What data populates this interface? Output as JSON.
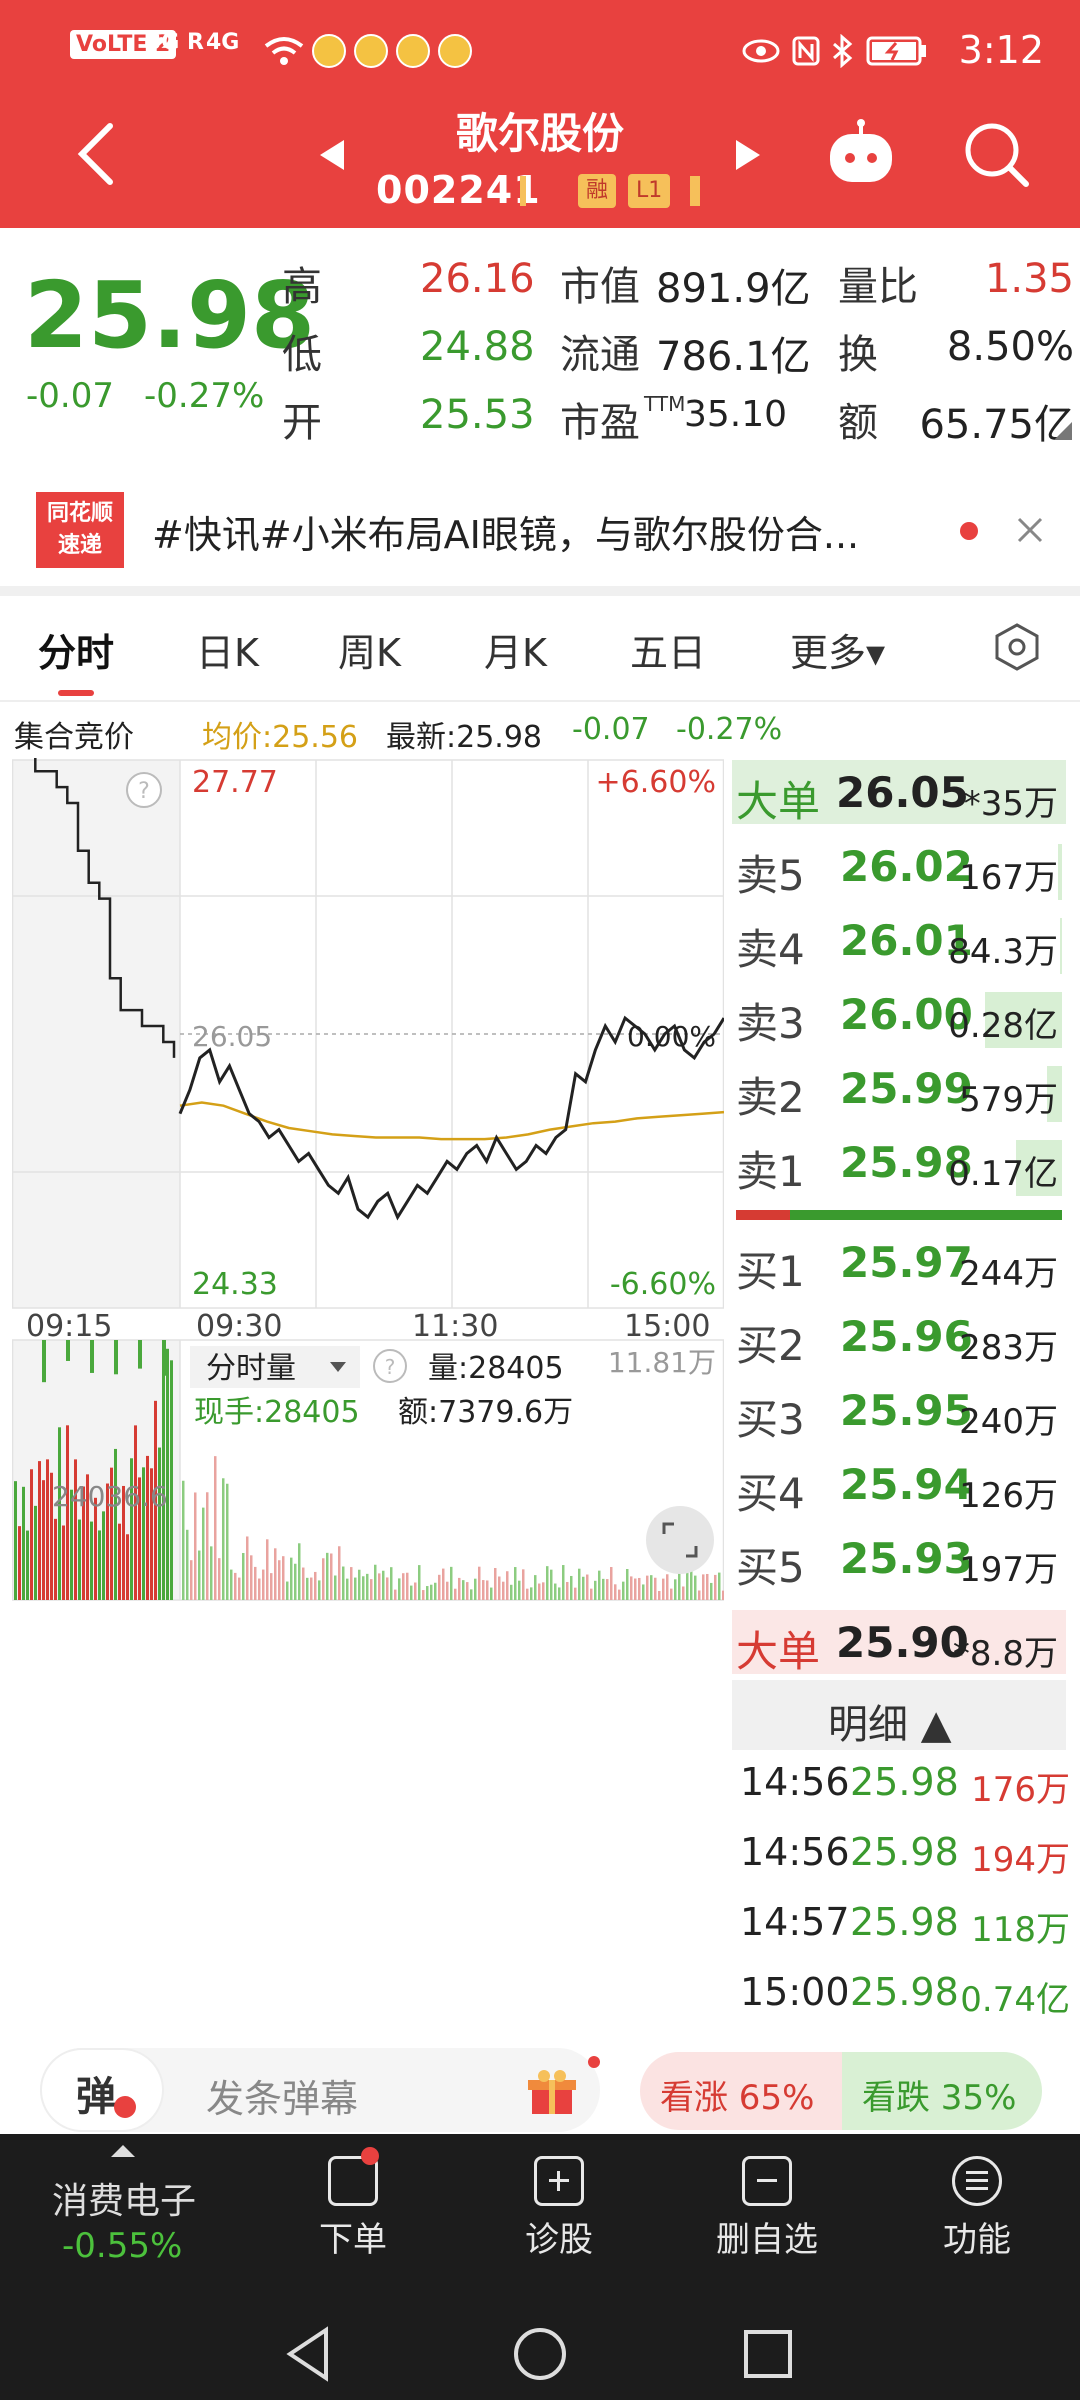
{
  "status_bar": {
    "time": "3:12",
    "signals": [
      "VoLTE 2",
      "3G R",
      "4G"
    ],
    "wifi_icon": "wifi-icon",
    "bluetooth_icon": "bluetooth-icon",
    "nfc_icon": "nfc-icon",
    "eye_icon": "eye-icon",
    "battery_icon": "battery-icon"
  },
  "header": {
    "stock_name": "歌尔股份",
    "stock_code": "002241",
    "tags": [
      "融",
      "L1"
    ],
    "brand_color": "#e8413f"
  },
  "quote": {
    "price": "25.98",
    "change": "-0.07",
    "change_pct": "-0.27%",
    "stats": {
      "high_label": "高",
      "high": "26.16",
      "low_label": "低",
      "low": "24.88",
      "open_label": "开",
      "open": "25.53",
      "mcap_label": "市值",
      "mcap": "891.9亿",
      "float_label": "流通",
      "float": "786.1亿",
      "pe_label": "市盈",
      "pe_suffix": "TTM",
      "pe": "35.10",
      "vr_label": "量比",
      "vr": "1.35",
      "turn_label": "换",
      "turn": "8.50%",
      "amt_label": "额",
      "amt": "65.75亿"
    }
  },
  "news": {
    "logo_top": "同花顺",
    "logo_bottom": "速递",
    "text": "#快讯#小米布局AI眼镜，与歌尔股份合..."
  },
  "tabs": [
    "分时",
    "日K",
    "周K",
    "月K",
    "五日",
    "更多▾"
  ],
  "chart_header": {
    "auction": "集合竞价",
    "avg": "均价:25.56",
    "latest": "最新:25.98",
    "chg": "-0.07",
    "chg_pct": "-0.27%"
  },
  "chart_data": {
    "type": "line",
    "price_axis": {
      "max": 27.77,
      "min": 24.33,
      "ref": 26.05,
      "max_pct": "+6.60%",
      "min_pct": "-6.60%",
      "ref_pct": "0.00%"
    },
    "y_labels": {
      "top": "27.77",
      "bottom": "24.33",
      "mid": "26.05",
      "top_pct": "+6.60%",
      "bottom_pct": "-6.60%",
      "mid_pct": "0.00%"
    },
    "x_labels": [
      "09:15",
      "09:30",
      "11:30",
      "15:00"
    ],
    "auction_series": [
      27.8,
      27.8,
      27.7,
      27.7,
      27.6,
      27.5,
      27.2,
      27.0,
      26.9,
      26.4,
      26.2,
      26.2,
      26.1,
      26.1,
      26.0,
      25.9
    ],
    "price_series": [
      25.55,
      25.7,
      25.9,
      25.95,
      25.75,
      25.85,
      25.7,
      25.55,
      25.5,
      25.4,
      25.45,
      25.35,
      25.25,
      25.3,
      25.2,
      25.1,
      25.05,
      25.15,
      24.95,
      24.9,
      25.0,
      25.05,
      24.9,
      25.0,
      25.1,
      25.05,
      25.15,
      25.25,
      25.2,
      25.3,
      25.35,
      25.25,
      25.4,
      25.3,
      25.2,
      25.25,
      25.35,
      25.3,
      25.4,
      25.45,
      25.8,
      25.75,
      25.95,
      26.1,
      26.0,
      26.15,
      26.1,
      26.05,
      25.95,
      26.05,
      26.1,
      25.95,
      25.9,
      26.0,
      26.05,
      26.15
    ],
    "avg_series": [
      25.6,
      25.62,
      25.6,
      25.55,
      25.5,
      25.46,
      25.44,
      25.42,
      25.41,
      25.4,
      25.4,
      25.4,
      25.39,
      25.39,
      25.39,
      25.4,
      25.42,
      25.45,
      25.47,
      25.49,
      25.5,
      25.52,
      25.53,
      25.54,
      25.55,
      25.56
    ],
    "volume": {
      "label": "分时量",
      "vol_label": "量:28405",
      "max_label": "11.81万",
      "hand_label": "现手:28405",
      "amount_label": "额:7379.6万",
      "auction_label": "24036.6"
    }
  },
  "order_book": {
    "big_sell": {
      "label": "大单",
      "price": "26.05",
      "vol": "*35万"
    },
    "sells": [
      {
        "label": "卖5",
        "price": "26.02",
        "vol": "167万",
        "share": 0.04
      },
      {
        "label": "卖4",
        "price": "26.01",
        "vol": "84.3万",
        "share": 0.02
      },
      {
        "label": "卖3",
        "price": "26.00",
        "vol": "0.28亿",
        "share": 0.7
      },
      {
        "label": "卖2",
        "price": "25.99",
        "vol": "579万",
        "share": 0.14
      },
      {
        "label": "卖1",
        "price": "25.98",
        "vol": "0.17亿",
        "share": 0.42
      }
    ],
    "buys": [
      {
        "label": "买1",
        "price": "25.97",
        "vol": "244万"
      },
      {
        "label": "买2",
        "price": "25.96",
        "vol": "283万"
      },
      {
        "label": "买3",
        "price": "25.95",
        "vol": "240万"
      },
      {
        "label": "买4",
        "price": "25.94",
        "vol": "126万"
      },
      {
        "label": "买5",
        "price": "25.93",
        "vol": "197万"
      }
    ],
    "big_buy": {
      "label": "大单",
      "price": "25.90",
      "vol": "*8.8万"
    }
  },
  "detail": {
    "title": "明细 ▲",
    "rows": [
      {
        "time": "14:56",
        "price": "25.98",
        "vol": "176万",
        "color": "red"
      },
      {
        "time": "14:56",
        "price": "25.98",
        "vol": "194万",
        "color": "red"
      },
      {
        "time": "14:57",
        "price": "25.98",
        "vol": "118万",
        "color": "green"
      },
      {
        "time": "15:00",
        "price": "25.98",
        "vol": "0.74亿",
        "color": "green"
      }
    ]
  },
  "danmu": {
    "icon_label": "弹",
    "placeholder": "发条弹幕",
    "up": "看涨 65%",
    "down": "看跌 35%"
  },
  "bottom_bar": {
    "sector": "消费电子",
    "sector_change": "-0.55%",
    "items": [
      {
        "label": "下单",
        "icon": "order-icon"
      },
      {
        "label": "诊股",
        "icon": "diagnose-icon"
      },
      {
        "label": "删自选",
        "icon": "remove-watchlist-icon"
      },
      {
        "label": "功能",
        "icon": "menu-icon"
      }
    ]
  }
}
